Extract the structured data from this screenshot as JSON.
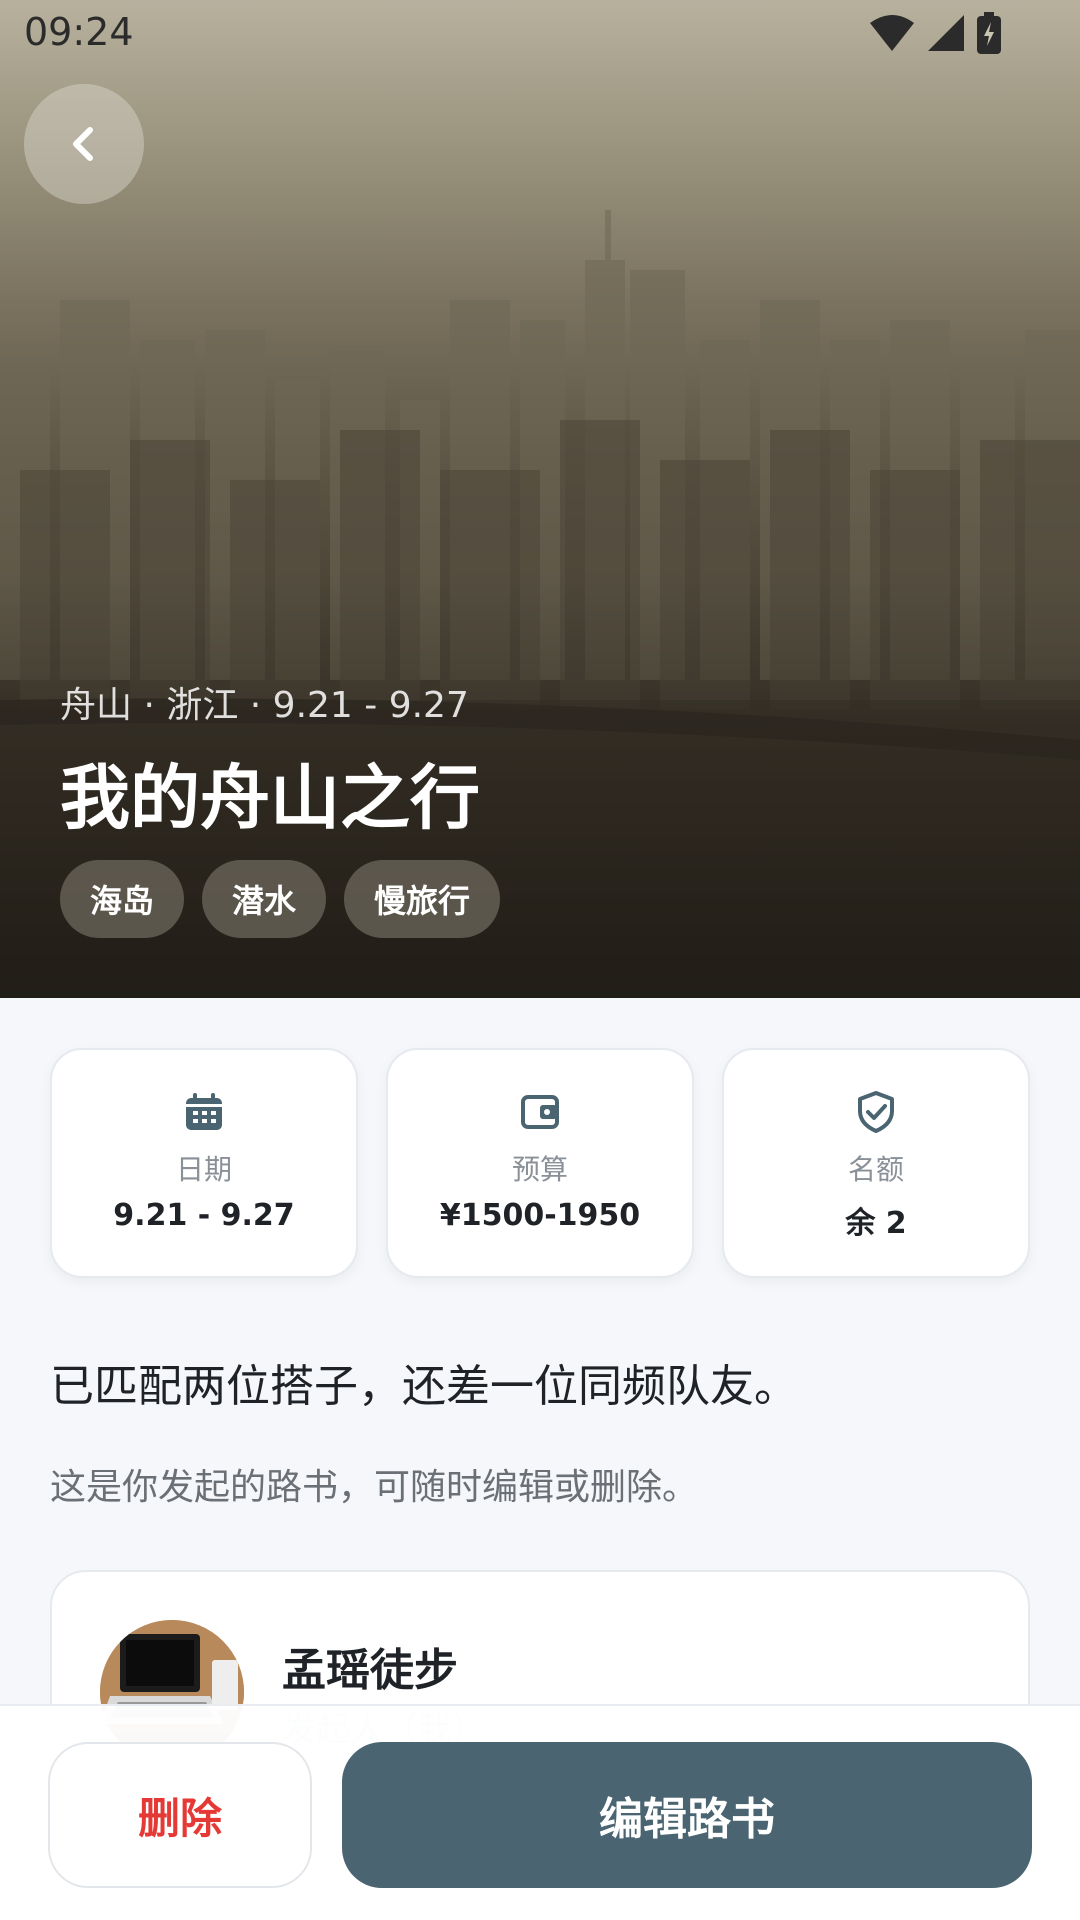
{
  "status_bar": {
    "time": "09:24"
  },
  "hero": {
    "meta": "舟山 · 浙江 · 9.21 - 9.27",
    "title": "我的舟山之行",
    "tags": [
      "海岛",
      "潜水",
      "慢旅行"
    ]
  },
  "stats": [
    {
      "icon": "calendar-icon",
      "label": "日期",
      "value": "9.21 - 9.27"
    },
    {
      "icon": "wallet-icon",
      "label": "预算",
      "value": "¥1500-1950"
    },
    {
      "icon": "shield-check-icon",
      "label": "名额",
      "value": "余 2"
    }
  ],
  "headline": "已匹配两位搭子，还差一位同频队友。",
  "subtext": "这是你发起的路书，可随时编辑或删除。",
  "organizer": {
    "name": "孟瑶徒步",
    "role": "发起人（我）"
  },
  "actions": {
    "delete_label": "删除",
    "edit_label": "编辑路书"
  },
  "colors": {
    "primary": "#4a6571",
    "danger": "#e53935",
    "background": "#f5f7fa"
  }
}
